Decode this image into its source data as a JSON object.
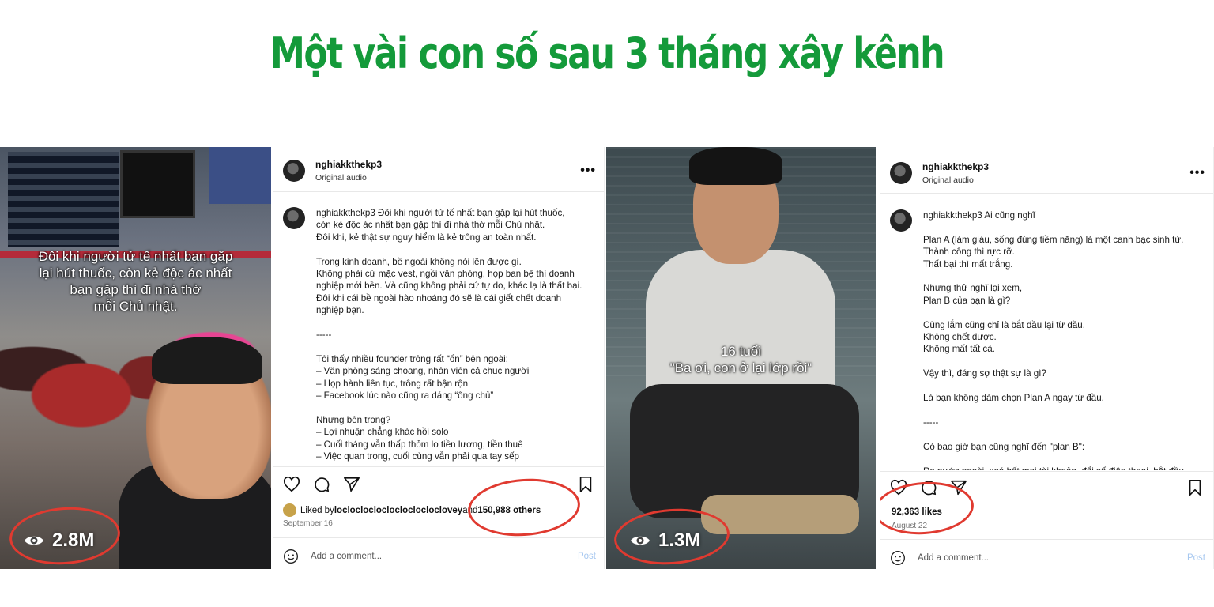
{
  "headline": "Một vài con số sau 3 tháng xây kênh",
  "video1": {
    "caption": "Đôi khi người tử tế nhất bạn gặp\nlại hút thuốc, còn kẻ độc ác nhất\nbạn gặp thì đi nhà thờ\nmỗi Chủ nhật.",
    "views": "2.8M",
    "icon": "eye-icon"
  },
  "post1": {
    "username": "nghiakkthekp3",
    "subtitle": "Original audio",
    "more": "•••",
    "caption_user": "nghiakkthekp3",
    "caption": " Đôi khi người tử tế nhất bạn gặp lại hút thuốc,\ncòn kẻ độc ác nhất bạn gặp thì đi nhà thờ mỗi Chủ nhật.\nĐôi khi, kẻ thật sự nguy hiểm là kẻ trông an toàn nhất.\n\nTrong kinh doanh, bề ngoài không nói lên được gì.\nKhông phải cứ mặc vest, ngồi văn phòng, họp ban bệ thì doanh\nnghiệp mới bền. Và cũng không phải cứ tự do, khác lạ là thất bại.\nĐôi khi cái bề ngoài hào nhoáng đó sẽ là cái giết chết doanh\nnghiệp bạn.\n\n-----\n\nTôi thấy nhiều founder trông rất “ổn” bên ngoài:\n– Văn phòng sáng choang, nhân viên cả chục người\n– Họp hành liên tục, trông rất bận rộn\n– Facebook lúc nào cũng ra dáng “ông chủ”\n\nNhưng bên trong?\n– Lợi nhuận chẳng khác hồi solo\n– Cuối tháng vẫn thấp thỏm lo tiền lương, tiền thuê\n– Việc quan trọng, cuối cùng vẫn phải qua tay sếp",
    "liked_prefix": "Liked by ",
    "liked_user": "locloclocloclocloclocloclovey",
    "liked_and": " and ",
    "liked_others": "150,988 others",
    "date": "September 16",
    "comment_placeholder": "Add a comment...",
    "post_button": "Post"
  },
  "video2": {
    "caption": "16 tuổi\n\"Ba ơi, con ở lại lớp rồi\"",
    "views": "1.3M",
    "icon": "eye-icon"
  },
  "post2": {
    "username": "nghiakkthekp3",
    "subtitle": "Original audio",
    "more": "•••",
    "caption_user": "nghiakkthekp3",
    "caption": " Ai cũng nghĩ\n\nPlan A (làm giàu, sống đúng tiềm năng) là một canh bạc sinh tử.\nThành công thì rực rỡ.\nThất bại thì mất trắng.\n\nNhưng thử nghĩ lại xem,\nPlan B của bạn là gì?\n\nCùng lắm cũng chỉ là bắt đầu lại từ đầu.\nKhông chết được.\nKhông mất tất cả.\n\nVậy thì, đáng sợ thật sự là gì?\n\nLà bạn không dám chọn Plan A ngay từ đầu.\n\n-----\n\nCó bao giờ bạn cũng nghĩ đến \"plan B\":\n\nRa nước ngoài, xoá hết mọi tài khoản, đổi số điện thoại, bắt đầu",
    "likes": "92,363 likes",
    "date": "August 22",
    "comment_placeholder": "Add a comment...",
    "post_button": "Post"
  },
  "colors": {
    "headline": "#149a3a",
    "highlight_circle": "#e03a30",
    "post_button": "#a7c8f0"
  }
}
